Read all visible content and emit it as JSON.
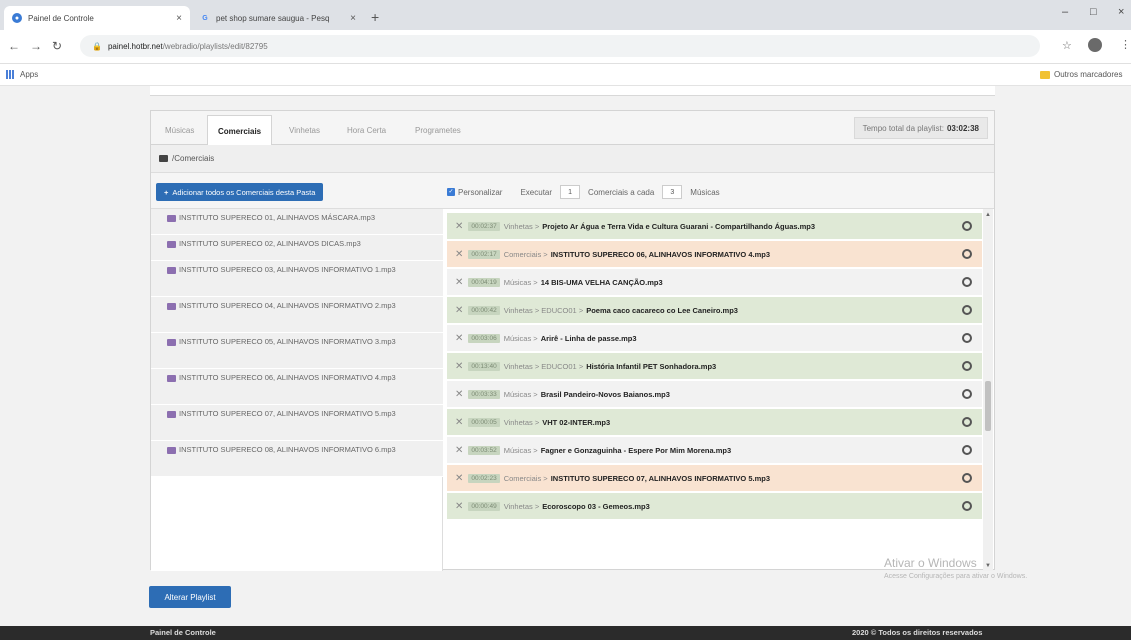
{
  "browser": {
    "tabs": [
      {
        "title": "Painel de Controle",
        "close": "×"
      },
      {
        "title": "pet shop sumare saugua - Pesq",
        "close": "×"
      }
    ],
    "new_tab": "+",
    "window_controls": [
      "–",
      "□",
      "×"
    ],
    "url_host": "painel.hotbr.net",
    "url_path": "/webradio/playlists/edit/82795",
    "bookmarks": {
      "apps": "Apps",
      "other": "Outros marcadores"
    }
  },
  "panel": {
    "tabs": [
      "Músicas",
      "Comerciais",
      "Vinhetas",
      "Hora Certa",
      "Programetes"
    ],
    "active_tab": "Comerciais",
    "total_label": "Tempo total da playlist:",
    "total_value": "03:02:38",
    "path": "/Comerciais",
    "add_all_label": "Adicionar todos os Comerciais desta Pasta",
    "personalizar": "Personalizar",
    "executar": "Executar",
    "executar_value": "1",
    "comerciais_a_cada": "Comerciais a cada",
    "cada_value": "3",
    "musicas": "Músicas"
  },
  "commercials": [
    "INSTITUTO SUPERECO 01, ALINHAVOS MÁSCARA.mp3",
    "INSTITUTO SUPERECO 02, ALINHAVOS DICAS.mp3",
    "INSTITUTO SUPERECO 03, ALINHAVOS INFORMATIVO 1.mp3",
    "INSTITUTO SUPERECO 04, ALINHAVOS INFORMATIVO 2.mp3",
    "INSTITUTO SUPERECO 05, ALINHAVOS INFORMATIVO 3.mp3",
    "INSTITUTO SUPERECO 06, ALINHAVOS INFORMATIVO 4.mp3",
    "INSTITUTO SUPERECO 07, ALINHAVOS INFORMATIVO 5.mp3",
    "INSTITUTO SUPERECO 08, ALINHAVOS INFORMATIVO 6.mp3"
  ],
  "playlist": [
    {
      "type": "vin",
      "dur": "00:02:37",
      "cat": "Vinhetas >",
      "file": "Projeto Ar Água e Terra Vida e Cultura Guarani - Compartilhando Águas.mp3"
    },
    {
      "type": "com",
      "dur": "00:02:17",
      "cat": "Comerciais >",
      "file": "INSTITUTO SUPERECO 06, ALINHAVOS INFORMATIVO 4.mp3"
    },
    {
      "type": "mus",
      "dur": "00:04:19",
      "cat": "Músicas >",
      "file": "14 BIS-UMA VELHA CANÇÃO.mp3"
    },
    {
      "type": "vin",
      "dur": "00:00:42",
      "cat": "Vinhetas > EDUCO01 >",
      "file": "Poema caco cacareco co Lee Caneiro.mp3"
    },
    {
      "type": "mus",
      "dur": "00:03:06",
      "cat": "Músicas >",
      "file": "Arirê - Linha de passe.mp3"
    },
    {
      "type": "vin",
      "dur": "00:13:40",
      "cat": "Vinhetas > EDUCO01 >",
      "file": "História Infantil PET Sonhadora.mp3"
    },
    {
      "type": "mus",
      "dur": "00:03:33",
      "cat": "Músicas >",
      "file": "Brasil Pandeiro-Novos Baianos.mp3"
    },
    {
      "type": "vin",
      "dur": "00:00:05",
      "cat": "Vinhetas >",
      "file": "VHT 02-INTER.mp3"
    },
    {
      "type": "mus",
      "dur": "00:03:52",
      "cat": "Músicas >",
      "file": "Fagner e Gonzaguinha - Espere Por Mim Morena.mp3"
    },
    {
      "type": "com",
      "dur": "00:02:23",
      "cat": "Comerciais >",
      "file": "INSTITUTO SUPERECO 07, ALINHAVOS INFORMATIVO 5.mp3"
    },
    {
      "type": "vin",
      "dur": "00:00:49",
      "cat": "Vinhetas >",
      "file": "Ecoroscopo 03 - Gemeos.mp3"
    }
  ],
  "save_label": "Alterar Playlist",
  "watermark": {
    "line1": "Ativar o Windows",
    "line2": "Acesse Configurações para ativar o Windows."
  },
  "footer": {
    "left": "Painel de Controle",
    "right": "2020 © Todos os direitos reservados"
  }
}
